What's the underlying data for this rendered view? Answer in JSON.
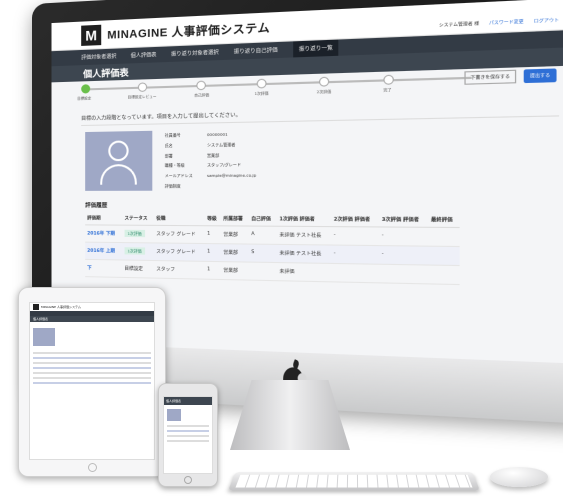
{
  "app": {
    "logo_letter": "M",
    "title": "MINAGINE 人事評価システム"
  },
  "nav": {
    "items": [
      "評価対象者選択",
      "個人評価表",
      "振り返り対象者選択",
      "振り返り自己評価",
      "振り返り一覧"
    ],
    "right_user": "システム管理者 様",
    "right_links": [
      "パスワード変更",
      "ログアウト"
    ]
  },
  "page": {
    "title": "個人評価表",
    "steps": [
      "目標設定",
      "目標設定レビュー",
      "自己評価",
      "1次評価",
      "2次評価",
      "完了"
    ],
    "step_link": "下書きを保存する",
    "step_button": "提出する",
    "notice": "目標の入力段階となっています。項目を入力して提出してください。"
  },
  "profile": {
    "fields": [
      {
        "label": "社員番号",
        "value": "00000001"
      },
      {
        "label": "氏名",
        "value": "システム管理者"
      },
      {
        "label": "部署",
        "value": "営業部"
      },
      {
        "label": "職種・等級",
        "value": "スタッフ/グレード"
      },
      {
        "label": "メールアドレス",
        "value": "sample@minagine.co.jp"
      },
      {
        "label": "評価制度",
        "value": ""
      }
    ]
  },
  "history": {
    "title": "評価履歴",
    "columns": [
      "評価期",
      "ステータス",
      "役職",
      "等級",
      "所属部署",
      "自己評価",
      "1次評価 評価者",
      "2次評価 評価者",
      "3次評価 評価者",
      "最終評価"
    ],
    "rows": [
      {
        "period": "2016年 下期",
        "status": "1次評価",
        "role": "スタッフ グレード",
        "grade": "1",
        "dept": "営業部",
        "self": "A",
        "first": "未評価 テスト社長",
        "second": "-",
        "third": "-",
        "final": ""
      },
      {
        "period": "2016年 上期",
        "status": "1次評価",
        "role": "スタッフ グレード",
        "grade": "1",
        "dept": "営業部",
        "self": "S",
        "first": "未評価 テスト社長",
        "second": "-",
        "third": "-",
        "final": ""
      },
      {
        "period": "下",
        "status": "目標設定",
        "role": "スタッフ",
        "grade": "1",
        "dept": "営業部",
        "self": "",
        "first": "未評価",
        "second": "",
        "third": "",
        "final": ""
      }
    ]
  },
  "mobile": {
    "page_title": "個人評価表"
  }
}
